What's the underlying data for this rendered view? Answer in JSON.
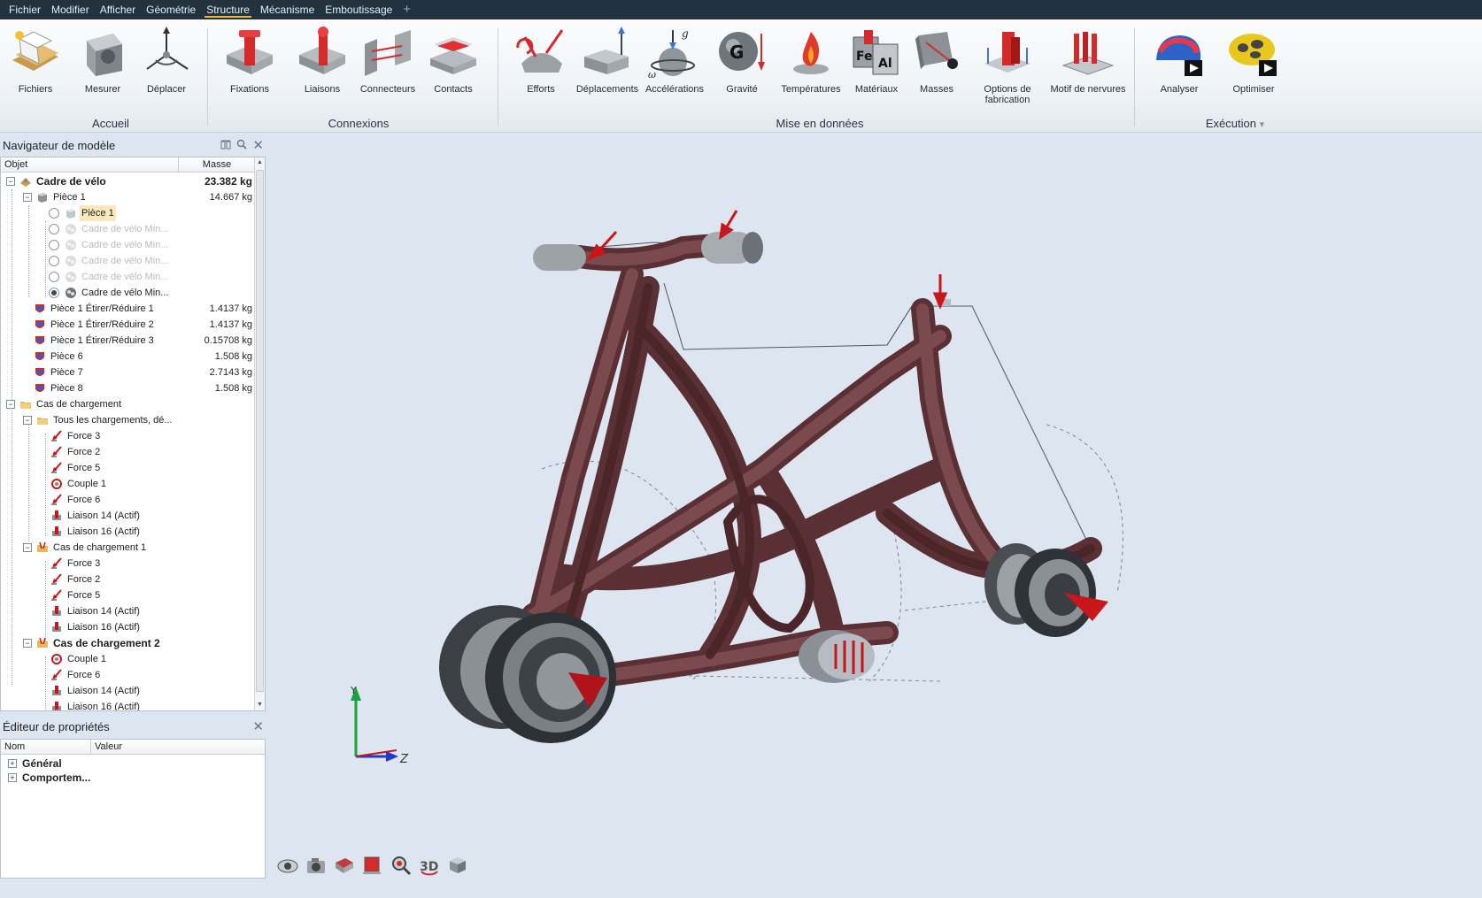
{
  "menu": [
    "Fichier",
    "Modifier",
    "Afficher",
    "Géométrie",
    "Structure",
    "Mécanisme",
    "Emboutissage"
  ],
  "menu_plus": "+",
  "ribbon": {
    "buttons": [
      {
        "label": "Fichiers",
        "icon": "files-icon"
      },
      {
        "label": "Mesurer",
        "icon": "measure-icon"
      },
      {
        "label": "Déplacer",
        "icon": "move-icon"
      },
      {
        "label": "Fixations",
        "icon": "fasteners-icon"
      },
      {
        "label": "Liaisons",
        "icon": "joints-icon"
      },
      {
        "label": "Connecteurs",
        "icon": "connectors-icon"
      },
      {
        "label": "Contacts",
        "icon": "contacts-icon"
      },
      {
        "label": "Efforts",
        "icon": "forces-icon"
      },
      {
        "label": "Déplacements",
        "icon": "displacements-icon"
      },
      {
        "label": "Accélérations",
        "icon": "accelerations-icon"
      },
      {
        "label": "Gravité",
        "icon": "gravity-icon"
      },
      {
        "label": "Températures",
        "icon": "temperatures-icon"
      },
      {
        "label": "Matériaux",
        "icon": "materials-icon"
      },
      {
        "label": "Masses",
        "icon": "masses-icon"
      },
      {
        "label": "Options de fabrication",
        "icon": "manufacturing-options-icon"
      },
      {
        "label": "Motif de nervures",
        "icon": "rib-pattern-icon"
      },
      {
        "label": "Analyser",
        "icon": "analyze-icon"
      },
      {
        "label": "Optimiser",
        "icon": "optimize-icon"
      }
    ],
    "groups": [
      "Accueil",
      "Connexions",
      "Mise en données",
      "Exécution"
    ],
    "group_dropdown": "▾"
  },
  "model_nav": {
    "title": "Navigateur de modèle",
    "col_object": "Objet",
    "col_mass": "Masse",
    "rows": [
      {
        "label": "Cadre de vélo",
        "mass": "23.382 kg",
        "bold": true
      },
      {
        "label": "Pièce 1",
        "mass": "14.667 kg"
      },
      {
        "label": "Pièce 1",
        "mass": ""
      },
      {
        "label": "Cadre de vélo Min...",
        "mass": ""
      },
      {
        "label": "Cadre de vélo Min...",
        "mass": ""
      },
      {
        "label": "Cadre de vélo Min...",
        "mass": ""
      },
      {
        "label": "Cadre de vélo Min...",
        "mass": ""
      },
      {
        "label": "Cadre de vélo Min...",
        "mass": ""
      },
      {
        "label": "Pièce 1 Étirer/Réduire 1",
        "mass": "1.4137 kg"
      },
      {
        "label": "Pièce 1 Étirer/Réduire 2",
        "mass": "1.4137 kg"
      },
      {
        "label": "Pièce 1 Étirer/Réduire 3",
        "mass": "0.15708 kg"
      },
      {
        "label": "Pièce 6",
        "mass": "1.508 kg"
      },
      {
        "label": "Pièce 7",
        "mass": "2.7143 kg"
      },
      {
        "label": "Pièce 8",
        "mass": "1.508 kg"
      },
      {
        "label": "Cas de chargement",
        "mass": ""
      },
      {
        "label": "Tous les chargements, dé...",
        "mass": ""
      },
      {
        "label": "Force 3",
        "mass": ""
      },
      {
        "label": "Force 2",
        "mass": ""
      },
      {
        "label": "Force 5",
        "mass": ""
      },
      {
        "label": "Couple 1",
        "mass": ""
      },
      {
        "label": "Force 6",
        "mass": ""
      },
      {
        "label": "Liaison 14 (Actif)",
        "mass": ""
      },
      {
        "label": "Liaison 16 (Actif)",
        "mass": ""
      },
      {
        "label": "Cas de chargement 1",
        "mass": ""
      },
      {
        "label": "Force 3",
        "mass": ""
      },
      {
        "label": "Force 2",
        "mass": ""
      },
      {
        "label": "Force 5",
        "mass": ""
      },
      {
        "label": "Liaison 14 (Actif)",
        "mass": ""
      },
      {
        "label": "Liaison 16 (Actif)",
        "mass": ""
      },
      {
        "label": "Cas de chargement 2",
        "mass": "",
        "bold": true
      },
      {
        "label": "Couple 1",
        "mass": ""
      },
      {
        "label": "Force 6",
        "mass": ""
      },
      {
        "label": "Liaison 14 (Actif)",
        "mass": ""
      },
      {
        "label": "Liaison 16 (Actif)",
        "mass": ""
      }
    ]
  },
  "props": {
    "title": "Éditeur de propriétés",
    "col_name": "Nom",
    "col_value": "Valeur",
    "rows": [
      {
        "label": "Général"
      },
      {
        "label": "Comportem..."
      }
    ]
  },
  "axis": {
    "y": "Y",
    "z": "Z"
  },
  "viewport_tools": [
    "view-eye-icon",
    "camera-icon",
    "section-icon",
    "plane-icon",
    "zoom-icon",
    "display-3d-icon",
    "cube-view-icon"
  ],
  "colors": {
    "accent": "#f2b233",
    "frame": "#6b3a3e",
    "load_arrow": "#c8161b",
    "menubar": "#22323f",
    "background": "#dde6f0"
  }
}
